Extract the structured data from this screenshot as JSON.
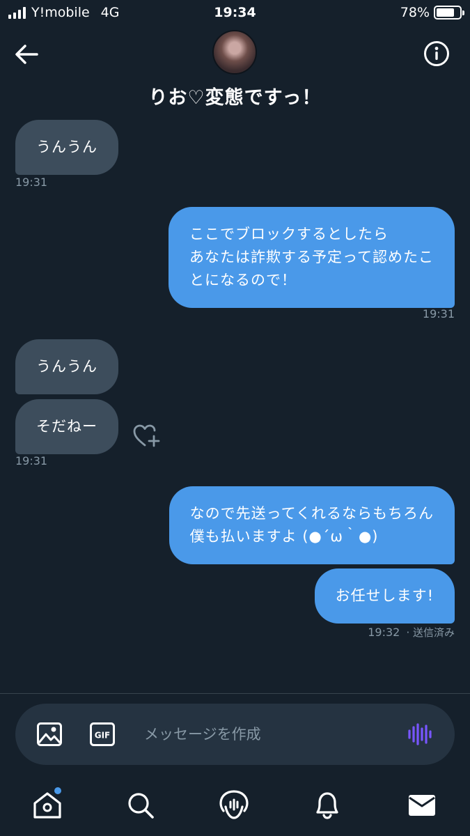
{
  "status_bar": {
    "carrier": "Y!mobile",
    "network": "4G",
    "time": "19:34",
    "battery_percent": "78%",
    "battery_level": 0.78
  },
  "header": {
    "title": "りお♡変態ですっ！",
    "back_icon": "arrow-left-icon",
    "info_icon": "info-icon"
  },
  "messages": [
    {
      "direction": "in",
      "text": "うんうん",
      "time": "19:31"
    },
    {
      "direction": "out",
      "lines": [
        "ここでブロックするとしたら",
        "あなたは詐欺する予定って認めたこ",
        "とになるので！"
      ],
      "time": "19:31"
    },
    {
      "direction": "in",
      "text": "うんうん"
    },
    {
      "direction": "in",
      "text": "そだねー",
      "time": "19:31"
    },
    {
      "direction": "out",
      "lines": [
        "なので先送ってくれるならもちろん",
        "僕も払いますよ (●´ω｀●)"
      ]
    },
    {
      "direction": "out",
      "text": "お任せします!",
      "time": "19:32",
      "status": "· 送信済み"
    }
  ],
  "composer": {
    "placeholder": "メッセージを作成",
    "gif_label": "GIF"
  },
  "tabs": [
    "home-icon",
    "search-icon",
    "spaces-icon",
    "notifications-icon",
    "messages-icon"
  ],
  "colors": {
    "background": "#15202b",
    "incoming_bubble": "#3d4d5c",
    "outgoing_bubble": "#4a99e9",
    "composer": "#253341",
    "muted_text": "#8899a6",
    "voice_accent": "#7856ff"
  }
}
